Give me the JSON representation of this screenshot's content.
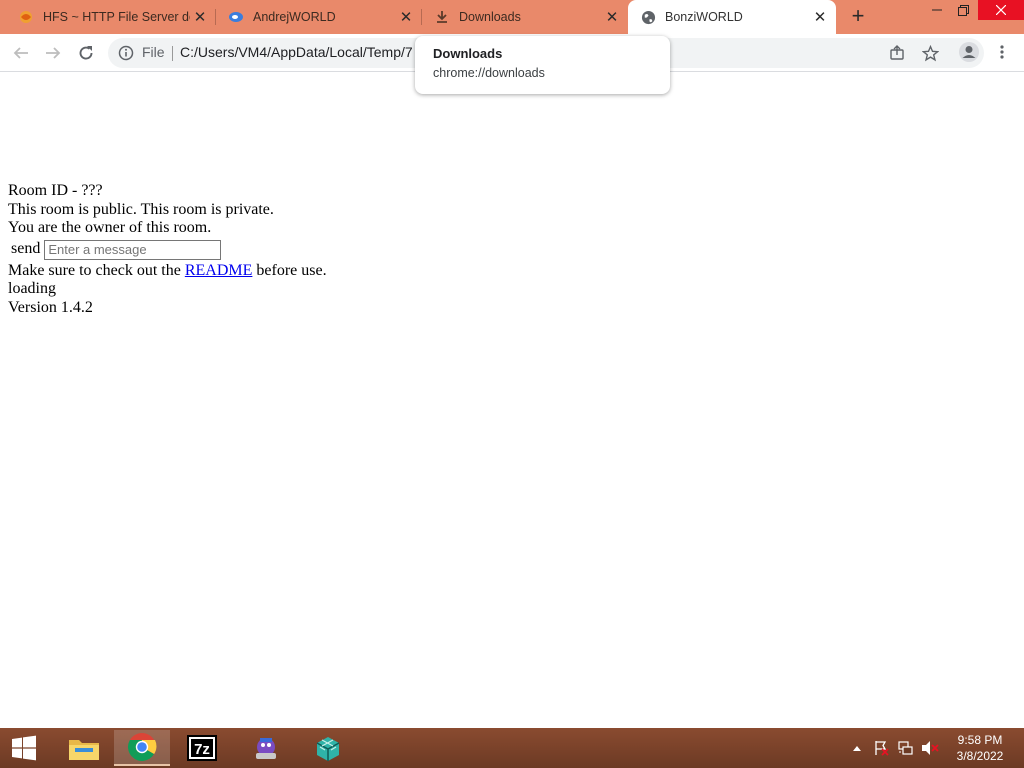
{
  "browser": {
    "tabs": [
      {
        "title": "HFS ~ HTTP File Server do",
        "icon": "hfs-favicon"
      },
      {
        "title": "AndrejWORLD",
        "icon": "cloud-favicon"
      },
      {
        "title": "Downloads",
        "icon": "download-icon"
      },
      {
        "title": "BonziWORLD",
        "icon": "globe-icon"
      }
    ],
    "active_tab": 3,
    "address": {
      "scheme_label": "File",
      "url": "C:/Users/VM4/AppData/Local/Temp/7"
    },
    "hover_card": {
      "title": "Downloads",
      "url": "chrome://downloads"
    }
  },
  "page": {
    "room_id": "Room ID - ???",
    "room_status": "This room is public. This room is private.",
    "owner_text": "You are the owner of this room.",
    "send_label": "send",
    "message_placeholder": "Enter a message",
    "readme_prefix": "Make sure to check out the ",
    "readme_link": "README",
    "readme_suffix": " before use.",
    "loading": "loading",
    "version": "Version 1.4.2"
  },
  "taskbar": {
    "apps": [
      "file-explorer",
      "chrome",
      "7-zip",
      "bonzi-buddy",
      "cube-app"
    ],
    "clock_time": "9:58 PM",
    "clock_date": "3/8/2022"
  },
  "colors": {
    "tabstrip": "#e9896a",
    "taskbar": "#7b4229",
    "link": "#0000ee"
  }
}
